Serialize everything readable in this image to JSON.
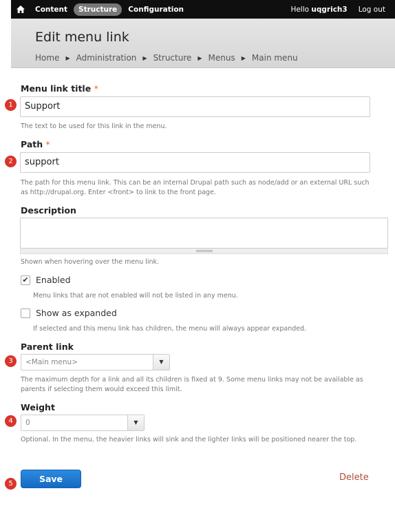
{
  "toolbar": {
    "items": [
      "Content",
      "Structure",
      "Configuration"
    ],
    "active": "Structure",
    "hello_prefix": "Hello",
    "username": "uqgrich3",
    "logout": "Log out"
  },
  "header": {
    "title": "Edit menu link",
    "breadcrumb": [
      "Home",
      "Administration",
      "Structure",
      "Menus",
      "Main menu"
    ]
  },
  "form": {
    "title": {
      "label": "Menu link title",
      "required": "*",
      "value": "Support",
      "help": "The text to be used for this link in the menu."
    },
    "path": {
      "label": "Path",
      "required": "*",
      "value": "support",
      "help_line1": "The path for this menu link. This can be an internal Drupal path such as node/add or an external URL such",
      "help_line2": "as http://drupal.org. Enter <front> to link to the front page."
    },
    "description": {
      "label": "Description",
      "value": "",
      "help": "Shown when hovering over the menu link."
    },
    "enabled": {
      "label": "Enabled",
      "checked": true,
      "help": "Menu links that are not enabled will not be listed in any menu."
    },
    "expanded": {
      "label": "Show as expanded",
      "checked": false,
      "help": "If selected and this menu link has children, the menu will always appear expanded."
    },
    "parent": {
      "label": "Parent link",
      "value": "<Main menu>",
      "help_line1": "The maximum depth for a link and all its children is fixed at 9. Some menu links may not be available as",
      "help_line2": "parents if selecting them would exceed this limit."
    },
    "weight": {
      "label": "Weight",
      "value": "0",
      "help": "Optional. In the menu, the heavier links will sink and the lighter links will be positioned nearer the top."
    },
    "save_label": "Save",
    "delete_label": "Delete"
  },
  "markers": [
    "1",
    "2",
    "3",
    "4",
    "5"
  ],
  "colors": {
    "toolbar_bg": "#0f0f0f",
    "accent_required": "#e26c27",
    "marker": "#d9352b",
    "save_button": "#1f7ad4",
    "delete_link": "#b44b3a"
  }
}
